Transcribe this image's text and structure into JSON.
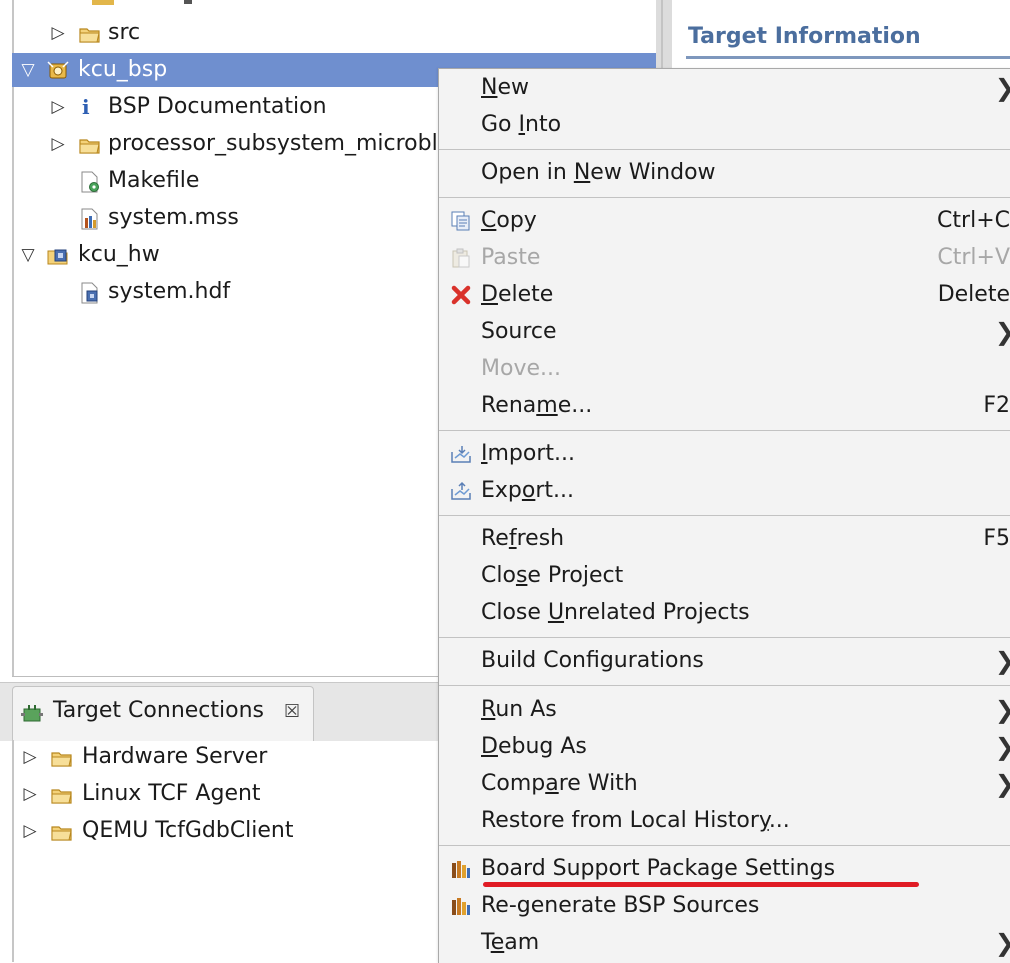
{
  "explorer": {
    "items": [
      {
        "label": "src",
        "indent": 1,
        "twisty": "▷",
        "icon": "folder-icon"
      },
      {
        "label": "kcu_bsp",
        "indent": 0,
        "twisty": "▽",
        "icon": "bsp-project-icon",
        "selected": true
      },
      {
        "label": "BSP Documentation",
        "indent": 1,
        "twisty": "▷",
        "icon": "info-icon"
      },
      {
        "label": "processor_subsystem_microbl",
        "indent": 1,
        "twisty": "▷",
        "icon": "folder-icon"
      },
      {
        "label": "Makefile",
        "indent": 2,
        "twisty": "",
        "icon": "makefile-icon"
      },
      {
        "label": "system.mss",
        "indent": 2,
        "twisty": "",
        "icon": "mss-file-icon"
      },
      {
        "label": "kcu_hw",
        "indent": 0,
        "twisty": "▽",
        "icon": "hw-project-icon"
      },
      {
        "label": "system.hdf",
        "indent": 2,
        "twisty": "",
        "icon": "hdf-file-icon"
      }
    ]
  },
  "editor": {
    "title": "Target Information"
  },
  "target_connections": {
    "tab_label": "Target Connections",
    "close_glyph": "☒",
    "items": [
      {
        "label": "Hardware Server"
      },
      {
        "label": "Linux TCF Agent"
      },
      {
        "label": "QEMU TcfGdbClient"
      }
    ]
  },
  "context_menu": {
    "items": [
      {
        "pre": "",
        "u": "N",
        "post": "ew",
        "shortcut": "",
        "submenu": true
      },
      {
        "pre": "Go ",
        "u": "I",
        "post": "nto",
        "shortcut": "",
        "submenu": false
      },
      {
        "pre": "Open in ",
        "u": "N",
        "post": "ew Window",
        "shortcut": "",
        "submenu": false
      },
      {
        "pre": "",
        "u": "C",
        "post": "opy",
        "shortcut": "Ctrl+C",
        "icon": "copy-icon"
      },
      {
        "pre": "Paste",
        "u": "",
        "post": "",
        "shortcut": "Ctrl+V",
        "icon": "paste-icon",
        "disabled": true
      },
      {
        "pre": "",
        "u": "D",
        "post": "elete",
        "shortcut": "Delete",
        "icon": "delete-icon"
      },
      {
        "pre": "Source",
        "u": "",
        "post": "",
        "shortcut": "",
        "submenu": true
      },
      {
        "pre": "Move...",
        "u": "",
        "post": "",
        "shortcut": "",
        "disabled": true
      },
      {
        "pre": "Rena",
        "u": "m",
        "post": "e...",
        "shortcut": "F2"
      },
      {
        "pre": "",
        "u": "I",
        "post": "mport...",
        "shortcut": "",
        "icon": "import-icon"
      },
      {
        "pre": "Exp",
        "u": "o",
        "post": "rt...",
        "shortcut": "",
        "icon": "export-icon"
      },
      {
        "pre": "Re",
        "u": "f",
        "post": "resh",
        "shortcut": "F5"
      },
      {
        "pre": "Clo",
        "u": "s",
        "post": "e Project",
        "shortcut": ""
      },
      {
        "pre": "Close ",
        "u": "U",
        "post": "nrelated Projects",
        "shortcut": ""
      },
      {
        "pre": "Build Configurations",
        "u": "",
        "post": "",
        "shortcut": "",
        "submenu": true
      },
      {
        "pre": "",
        "u": "R",
        "post": "un As",
        "shortcut": "",
        "submenu": true
      },
      {
        "pre": "",
        "u": "D",
        "post": "ebug As",
        "shortcut": "",
        "submenu": true
      },
      {
        "pre": "Comp",
        "u": "a",
        "post": "re With",
        "shortcut": "",
        "submenu": true
      },
      {
        "pre": "Restore from Local Histor",
        "u": "y",
        "post": "...",
        "shortcut": ""
      },
      {
        "pre": "Board Support Package Settings",
        "u": "",
        "post": "",
        "shortcut": "",
        "icon": "bsp-settings-icon",
        "highlighted": true
      },
      {
        "pre": "Re-generate BSP Sources",
        "u": "",
        "post": "",
        "shortcut": "",
        "icon": "bsp-regenerate-icon"
      },
      {
        "pre": "T",
        "u": "e",
        "post": "am",
        "shortcut": "",
        "submenu": true
      }
    ],
    "arrow_glyph": "❯"
  },
  "colors": {
    "selection": "#6f8fcf",
    "menu_bg": "#f3f3f3",
    "annotation": "#e01b24",
    "title_blue": "#4b6e9e"
  }
}
